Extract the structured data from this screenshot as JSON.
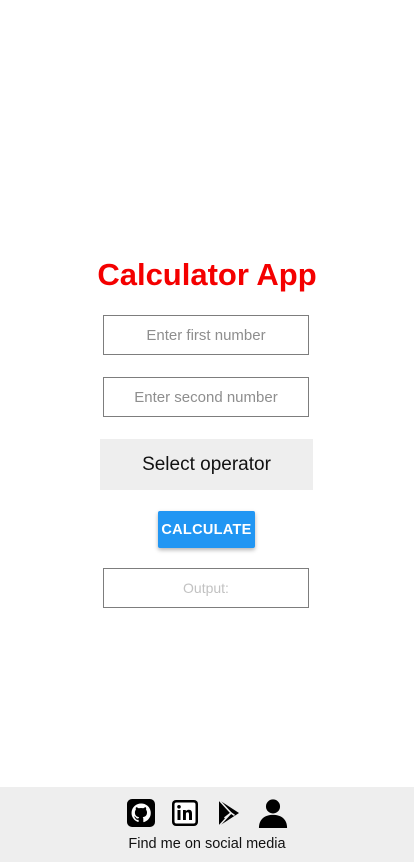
{
  "app": {
    "title": "Calculator App",
    "title_color": "#f40000"
  },
  "inputs": {
    "first_placeholder": "Enter first number",
    "second_placeholder": "Enter second number",
    "first_value": "",
    "second_value": ""
  },
  "operator": {
    "selected_label": "Select operator"
  },
  "calculate": {
    "label": "CALCULATE",
    "color": "#2196f3"
  },
  "output": {
    "label": "Output:"
  },
  "footer": {
    "social_icons": [
      "github-icon",
      "linkedin-icon",
      "play-store-icon",
      "profile-icon"
    ],
    "caption": "Find me on social media"
  }
}
